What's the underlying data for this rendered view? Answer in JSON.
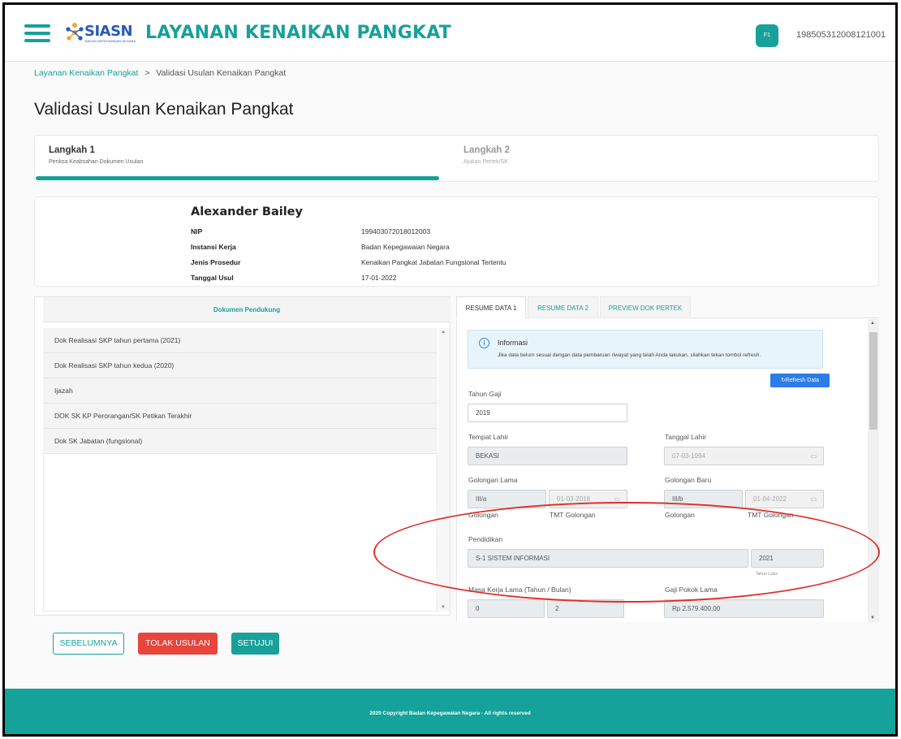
{
  "header": {
    "logo_text": "SIASN",
    "logo_sub": "BADAN KEPEGAWAIAN NEGARA",
    "title": "LAYANAN KENAIKAN PANGKAT",
    "avatar_initials": "F1",
    "user_nip": "198505312008121001"
  },
  "breadcrumb": {
    "root": "Layanan Kenaikan Pangkat",
    "separator": ">",
    "current": "Validasi Usulan Kenaikan Pangkat"
  },
  "page_title": "Validasi Usulan Kenaikan Pangkat",
  "stepper": {
    "steps": [
      {
        "title": "Langkah 1",
        "subtitle": "Periksa Keabsahan Dokumen Usulan"
      },
      {
        "title": "Langkah 2",
        "subtitle": "Ajukan Pertek/SK"
      }
    ]
  },
  "profile": {
    "name": "Alexander Bailey",
    "rows": [
      {
        "label": "NIP",
        "value": "199403072018012003"
      },
      {
        "label": "Instansi Kerja",
        "value": "Badan Kepegawaian Negara"
      },
      {
        "label": "Jenis Prosedur",
        "value": "Kenaikan Pangkat Jabatan Fungsional Tertentu"
      },
      {
        "label": "Tanggal Usul",
        "value": "17-01-2022"
      }
    ]
  },
  "docs": {
    "header": "Dokumen Pendukung",
    "items": [
      "Dok Realisasi SKP tahun pertama (2021)",
      "Dok Realisasi SKP tahun kedua (2020)",
      "Ijazah",
      "DOK SK KP Perorangan/SK Petikan Terakhir",
      "Dok SK Jabatan (fungsional)"
    ]
  },
  "tabs": [
    "RESUME DATA 1",
    "RESUME DATA 2",
    "PREVIEW DOK PERTEK"
  ],
  "info": {
    "title": "Informasi",
    "text": "Jika data belum sesuai dengan data pembaruan riwayat yang telah Anda lakukan, silahkan tekan tombol refresh."
  },
  "refresh_label": "↻Refresh Data",
  "form": {
    "tahun_gaji": {
      "label": "Tahun Gaji",
      "value": "2019"
    },
    "tempat_lahir": {
      "label": "Tempat Lahir",
      "value": "BEKASI"
    },
    "tanggal_lahir": {
      "label": "Tanggal Lahir",
      "value": "07-03-1994"
    },
    "golongan_lama": {
      "label": "Golongan Lama",
      "golongan": "III/a",
      "tmt": "01-03-2018",
      "golongan_hint": "Golongan",
      "tmt_hint": "TMT Golongan"
    },
    "golongan_baru": {
      "label": "Golongan Baru",
      "golongan": "III/b",
      "tmt": "01-04-2022",
      "golongan_hint": "Golongan",
      "tmt_hint": "TMT Golongan"
    },
    "pendidikan": {
      "label": "Pendidikan",
      "value": "S-1 SISTEM INFORMASI",
      "tahun": "2021",
      "tahun_hint": "Tahun Lulus"
    },
    "masa_kerja_lama": {
      "label": "Masa Kerja Lama (Tahun / Bulan)",
      "tahun": "0",
      "bulan": "2"
    },
    "gaji_pokok_lama": {
      "label": "Gaji Pokok Lama",
      "value": "Rp 2.579.400,00"
    }
  },
  "buttons": {
    "prev": "SEBELUMNYA",
    "reject": "TOLAK USULAN",
    "approve": "SETUJUI"
  },
  "footer": "2020 Copyright Badan Kepegawaian Negara - All rights reserved",
  "colors": {
    "primary": "#17a19a",
    "danger": "#e8453c",
    "info_blue": "#2b7de9",
    "annotation_red": "#e0302a"
  }
}
